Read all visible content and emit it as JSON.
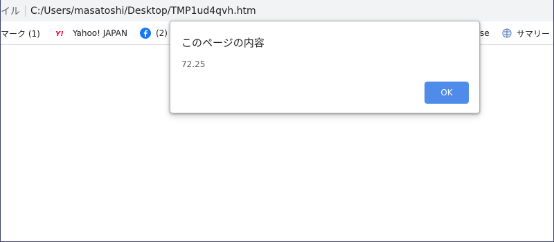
{
  "address_bar": {
    "prefix": "イル",
    "url": "C:/Users/masatoshi/Desktop/TMP1ud4qvh.htm"
  },
  "bookmarks": {
    "items": [
      {
        "label": "マーク (1)",
        "icon": "none"
      },
      {
        "label": "Yahoo! JAPAN",
        "icon": "yahoo-icon"
      },
      {
        "label": "(2) F",
        "icon": "facebook-icon"
      }
    ],
    "right_items": [
      {
        "label": "se",
        "icon": "none"
      },
      {
        "label": "サマリー",
        "icon": "globe-icon"
      }
    ]
  },
  "dialog": {
    "title": "このページの内容",
    "message": "72.25",
    "ok_label": "OK"
  },
  "colors": {
    "ok_button": "#4f8be8",
    "address_bar_bg": "#f1f3f4",
    "yahoo_red": "#ff0033",
    "facebook_blue": "#1877f2"
  }
}
